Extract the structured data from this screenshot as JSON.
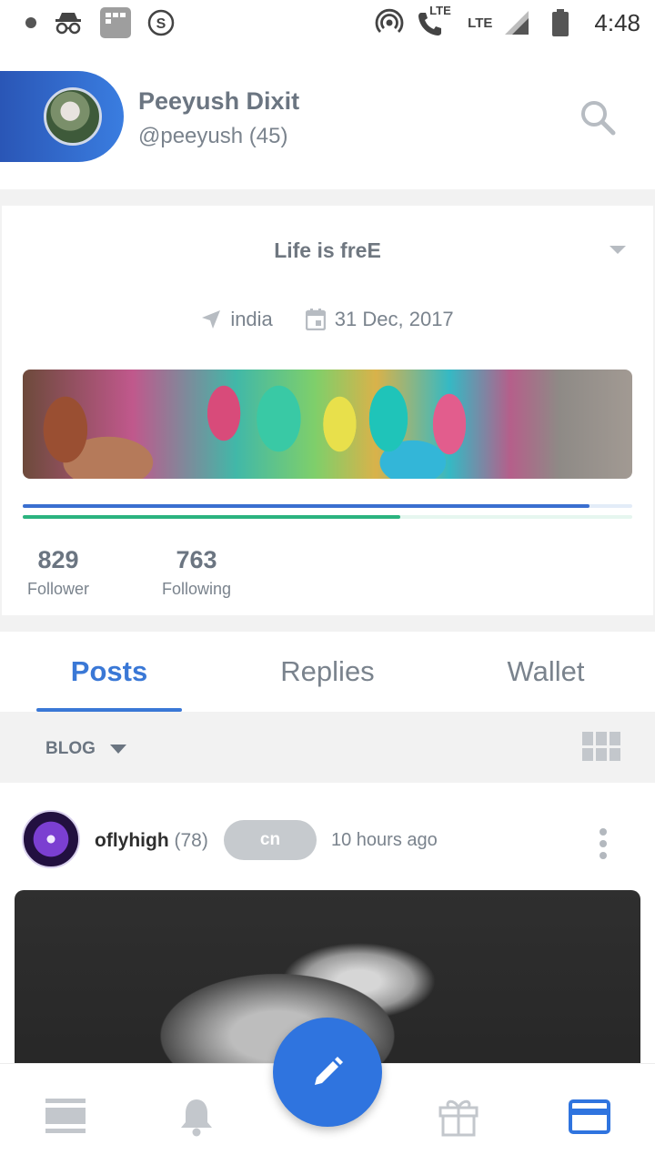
{
  "status_bar": {
    "time": "4:48",
    "lte_1": "LTE",
    "lte_2": "LTE"
  },
  "profile": {
    "name": "Peeyush Dixit",
    "handle": "@peeyush (45)",
    "bio": "Life is freE",
    "location": "india",
    "joined": "31 Dec, 2017",
    "voting_power_pct": 93,
    "resource_credit_pct": 62,
    "stats": [
      {
        "value": "829",
        "label": "Follower"
      },
      {
        "value": "763",
        "label": "Following"
      }
    ]
  },
  "tabs": [
    {
      "label": "Posts",
      "active": true
    },
    {
      "label": "Replies",
      "active": false
    },
    {
      "label": "Wallet",
      "active": false
    }
  ],
  "filter": {
    "selected": "BLOG"
  },
  "post": {
    "author": "oflyhigh",
    "reputation": "(78)",
    "tag": "cn",
    "time": "10 hours ago"
  },
  "colors": {
    "accent": "#3a78d6",
    "fab": "#2f74df",
    "progress_blue": "#3a6fd0",
    "progress_green": "#2bb37f"
  },
  "icons": {
    "status": [
      "incognito-icon",
      "app-grid-icon",
      "s-circle-icon",
      "hotspot-icon",
      "wifi-calling-icon",
      "signal-icon",
      "battery-icon"
    ],
    "bottom_nav": [
      "feed-icon",
      "bell-icon",
      "gift-icon",
      "wallet-card-icon"
    ],
    "fab": "pencil-icon"
  }
}
